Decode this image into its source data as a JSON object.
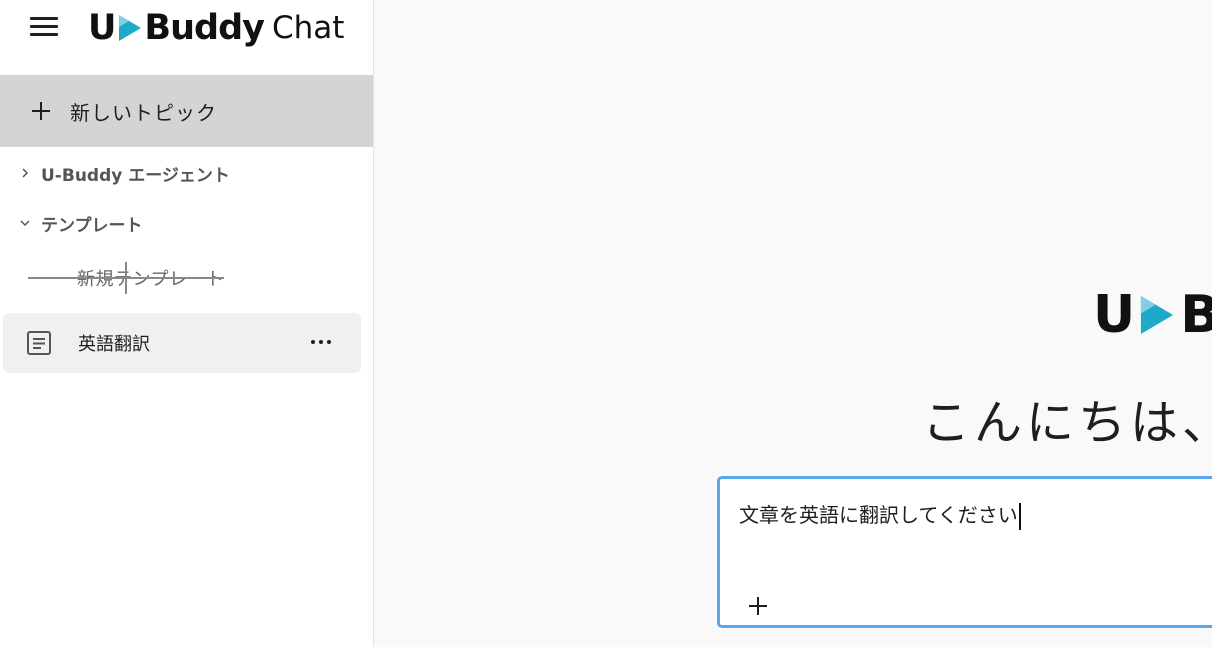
{
  "app": {
    "logo_left": "U",
    "logo_right": "Buddy",
    "logo_suffix": "Chat",
    "brand_color": "#1ea9c9"
  },
  "sidebar": {
    "new_topic_label": "新しいトピック",
    "sections": [
      {
        "label": "U-Buddy エージェント",
        "expanded": false
      },
      {
        "label": "テンプレート",
        "expanded": true
      }
    ],
    "new_template_label": "新規テンプレート",
    "templates": [
      {
        "label": "英語翻訳"
      }
    ]
  },
  "main": {
    "logo_left": "U",
    "logo_right": "B",
    "greeting": "こんにちは、",
    "prompt_value": "文章を英語に翻訳してください"
  },
  "icons": {
    "menu": "hamburger-icon",
    "add": "plus-icon",
    "collapsed": "chevron-right-icon",
    "expanded": "chevron-down-icon",
    "template": "document-icon",
    "more": "more-horizontal-icon"
  }
}
